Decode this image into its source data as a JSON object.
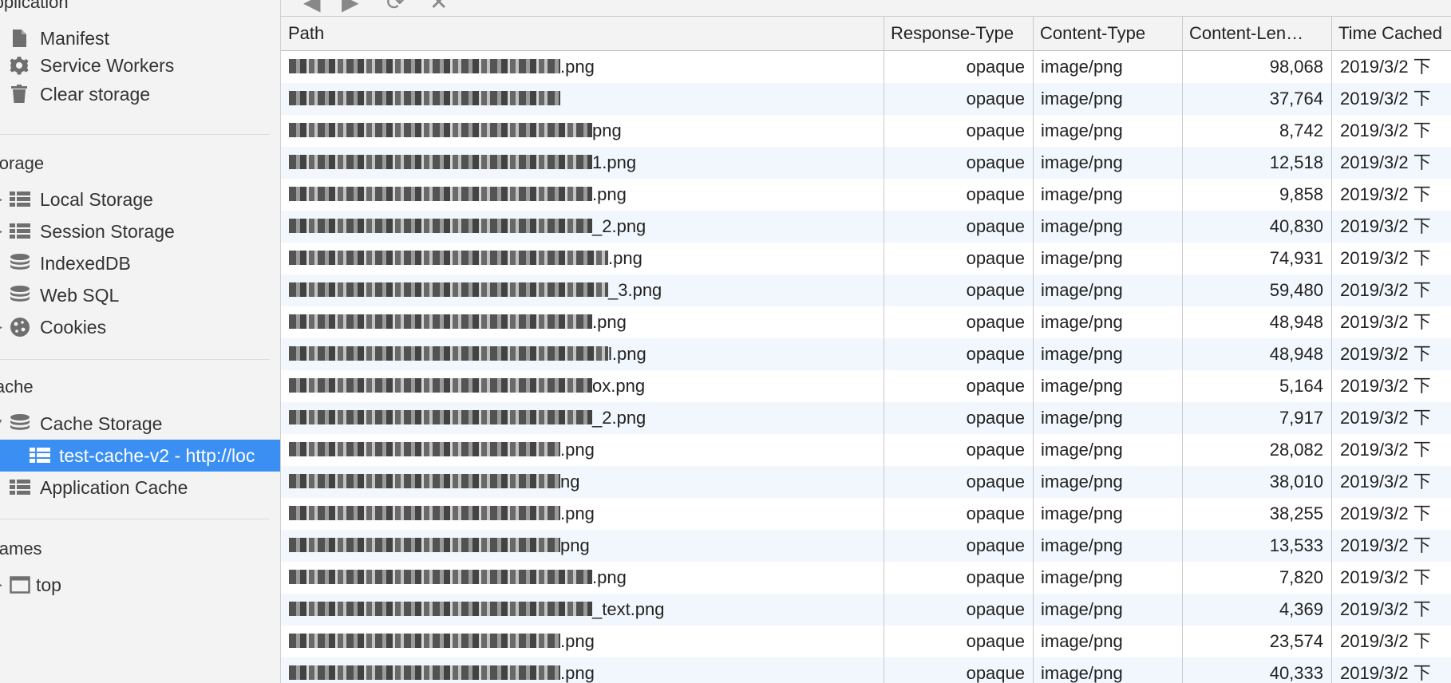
{
  "sidebar": {
    "application_title": "Application",
    "application_items": [
      {
        "label": "Manifest",
        "icon": "document-icon"
      },
      {
        "label": "Service Workers",
        "icon": "gear-icon"
      },
      {
        "label": "Clear storage",
        "icon": "trash-icon"
      }
    ],
    "storage_title": "Storage",
    "storage_items": [
      {
        "label": "Local Storage",
        "icon": "grid-icon"
      },
      {
        "label": "Session Storage",
        "icon": "grid-icon"
      },
      {
        "label": "IndexedDB",
        "icon": "database-icon"
      },
      {
        "label": "Web SQL",
        "icon": "database-icon"
      },
      {
        "label": "Cookies",
        "icon": "cookie-icon"
      }
    ],
    "cache_title": "Cache",
    "cache_items": [
      {
        "label": "Cache Storage",
        "icon": "database-icon"
      },
      {
        "label": "test-cache-v2 - http://loc",
        "icon": "grid-icon",
        "selected": true
      },
      {
        "label": "Application Cache",
        "icon": "grid-icon"
      }
    ],
    "frames_title": "Frames",
    "frames_items": [
      {
        "label": "top",
        "icon": "frame-icon"
      }
    ]
  },
  "table": {
    "headers": {
      "path": "Path",
      "response_type": "Response-Type",
      "content_type": "Content-Type",
      "content_length": "Content-Len…",
      "time_cached": "Time Cached"
    },
    "rows": [
      {
        "path_suffix": ".png",
        "response_type": "opaque",
        "content_type": "image/png",
        "content_length": "98,068",
        "time_cached": "2019/3/2 下"
      },
      {
        "path_suffix": "",
        "response_type": "opaque",
        "content_type": "image/png",
        "content_length": "37,764",
        "time_cached": "2019/3/2 下"
      },
      {
        "path_suffix": "png",
        "response_type": "opaque",
        "content_type": "image/png",
        "content_length": "8,742",
        "time_cached": "2019/3/2 下"
      },
      {
        "path_suffix": "1.png",
        "response_type": "opaque",
        "content_type": "image/png",
        "content_length": "12,518",
        "time_cached": "2019/3/2 下"
      },
      {
        "path_suffix": ".png",
        "response_type": "opaque",
        "content_type": "image/png",
        "content_length": "9,858",
        "time_cached": "2019/3/2 下"
      },
      {
        "path_suffix": "_2.png",
        "response_type": "opaque",
        "content_type": "image/png",
        "content_length": "40,830",
        "time_cached": "2019/3/2 下"
      },
      {
        "path_suffix": ".png",
        "response_type": "opaque",
        "content_type": "image/png",
        "content_length": "74,931",
        "time_cached": "2019/3/2 下"
      },
      {
        "path_suffix": "_3.png",
        "response_type": "opaque",
        "content_type": "image/png",
        "content_length": "59,480",
        "time_cached": "2019/3/2 下"
      },
      {
        "path_suffix": ".png",
        "response_type": "opaque",
        "content_type": "image/png",
        "content_length": "48,948",
        "time_cached": "2019/3/2 下"
      },
      {
        "path_suffix": "l.png",
        "response_type": "opaque",
        "content_type": "image/png",
        "content_length": "48,948",
        "time_cached": "2019/3/2 下"
      },
      {
        "path_suffix": "ox.png",
        "response_type": "opaque",
        "content_type": "image/png",
        "content_length": "5,164",
        "time_cached": "2019/3/2 下"
      },
      {
        "path_suffix": "_2.png",
        "response_type": "opaque",
        "content_type": "image/png",
        "content_length": "7,917",
        "time_cached": "2019/3/2 下"
      },
      {
        "path_suffix": ".png",
        "response_type": "opaque",
        "content_type": "image/png",
        "content_length": "28,082",
        "time_cached": "2019/3/2 下"
      },
      {
        "path_suffix": "ng",
        "response_type": "opaque",
        "content_type": "image/png",
        "content_length": "38,010",
        "time_cached": "2019/3/2 下"
      },
      {
        "path_suffix": ".png",
        "response_type": "opaque",
        "content_type": "image/png",
        "content_length": "38,255",
        "time_cached": "2019/3/2 下"
      },
      {
        "path_suffix": "png",
        "response_type": "opaque",
        "content_type": "image/png",
        "content_length": "13,533",
        "time_cached": "2019/3/2 下"
      },
      {
        "path_suffix": ".png",
        "response_type": "opaque",
        "content_type": "image/png",
        "content_length": "7,820",
        "time_cached": "2019/3/2 下"
      },
      {
        "path_suffix": "_text.png",
        "response_type": "opaque",
        "content_type": "image/png",
        "content_length": "4,369",
        "time_cached": "2019/3/2 下"
      },
      {
        "path_suffix": ".png",
        "response_type": "opaque",
        "content_type": "image/png",
        "content_length": "23,574",
        "time_cached": "2019/3/2 下"
      },
      {
        "path_suffix": ".png",
        "response_type": "opaque",
        "content_type": "image/png",
        "content_length": "40,333",
        "time_cached": "2019/3/2 下"
      }
    ]
  },
  "colors": {
    "selection": "#3b8ff3",
    "alt_row": "#f2f7fd",
    "sidebar_bg": "#f3f3f3"
  }
}
